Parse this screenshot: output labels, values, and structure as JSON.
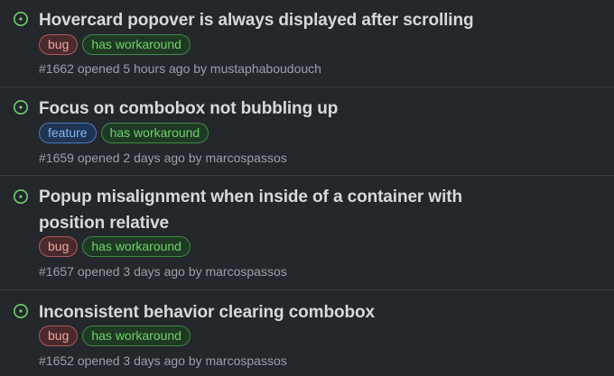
{
  "status_color": "#6fd26c",
  "issues": [
    {
      "title": "Hovercard popover is always displayed after scrolling",
      "labels": [
        {
          "text": "bug",
          "kind": "bug"
        },
        {
          "text": "has workaround",
          "kind": "workaround"
        }
      ],
      "meta": "#1662 opened 5 hours ago by mustaphaboudouch"
    },
    {
      "title": "Focus on combobox not bubbling up",
      "labels": [
        {
          "text": "feature",
          "kind": "feature"
        },
        {
          "text": "has workaround",
          "kind": "workaround"
        }
      ],
      "meta": "#1659 opened 2 days ago by marcospassos"
    },
    {
      "title": "Popup misalignment when inside of a container with position relative",
      "labels": [
        {
          "text": "bug",
          "kind": "bug"
        },
        {
          "text": "has workaround",
          "kind": "workaround"
        }
      ],
      "meta": "#1657 opened 3 days ago by marcospassos"
    },
    {
      "title": "Inconsistent behavior clearing combobox",
      "labels": [
        {
          "text": "bug",
          "kind": "bug"
        },
        {
          "text": "has workaround",
          "kind": "workaround"
        }
      ],
      "meta": "#1652 opened 3 days ago by marcospassos"
    }
  ]
}
